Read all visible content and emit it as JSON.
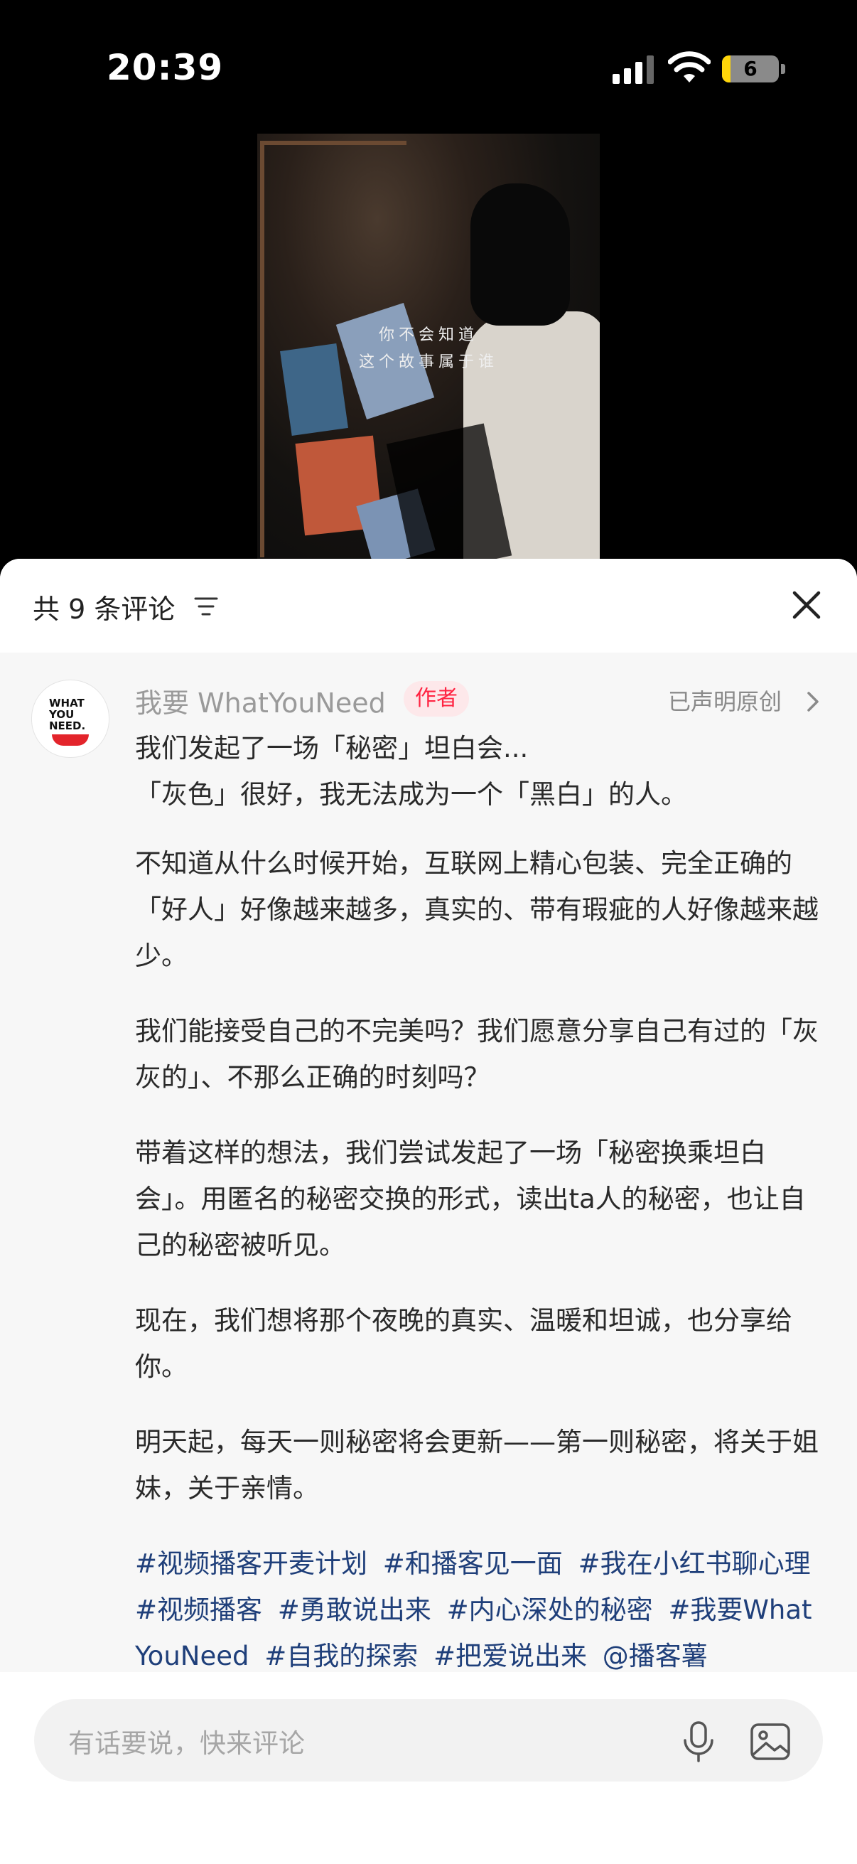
{
  "status_bar": {
    "time": "20:39",
    "battery": "6",
    "icons": [
      "cellular-signal-icon",
      "wifi-icon",
      "battery-icon"
    ]
  },
  "video": {
    "subtitle_line1": "你不会知道",
    "subtitle_line2": "这个故事属于谁"
  },
  "comments_header": {
    "count_label": "共 9 条评论",
    "icons": [
      "sort-icon",
      "close-icon"
    ]
  },
  "author_comment": {
    "avatar_text": "WHAT YOU NEED.",
    "author_name": "我要 WhatYouNeed",
    "author_badge": "作者",
    "original_tag": "已声明原创",
    "paragraphs": [
      "我们发起了一场「秘密」坦白会...\n「灰色」很好，我无法成为一个「黑白」的人。",
      "不知道从什么时候开始，互联网上精心包装、完全正确的「好人」好像越来越多，真实的、带有瑕疵的人好像越来越少。",
      "我们能接受自己的不完美吗？我们愿意分享自己有过的「灰灰的」、不那么正确的时刻吗？",
      "带着这样的想法，我们尝试发起了一场「秘密换乘坦白会」。用匿名的秘密交换的形式，读出ta人的秘密，也让自己的秘密被听见。",
      "现在，我们想将那个夜晚的真实、温暖和坦诚，也分享给你。",
      "明天起，每天一则秘密将会更新——第一则秘密，将关于姐妹，关于亲情。"
    ],
    "tags": [
      "#视频播客开麦计划",
      "#和播客见一面",
      "#我在小红书聊心理",
      "#视频播客",
      "#勇敢说出来",
      "#内心深处的秘密",
      "#我要WhatYouNeed",
      "#自我的探索",
      "#把爱说出来",
      "@播客薯"
    ]
  },
  "comment_input": {
    "placeholder": "有话要说，快来评论",
    "icons": [
      "microphone-icon",
      "image-icon"
    ]
  },
  "colors": {
    "accent": "#ff2442",
    "tag_link": "#1f3f7a",
    "battery_low": "#ffd60a"
  }
}
